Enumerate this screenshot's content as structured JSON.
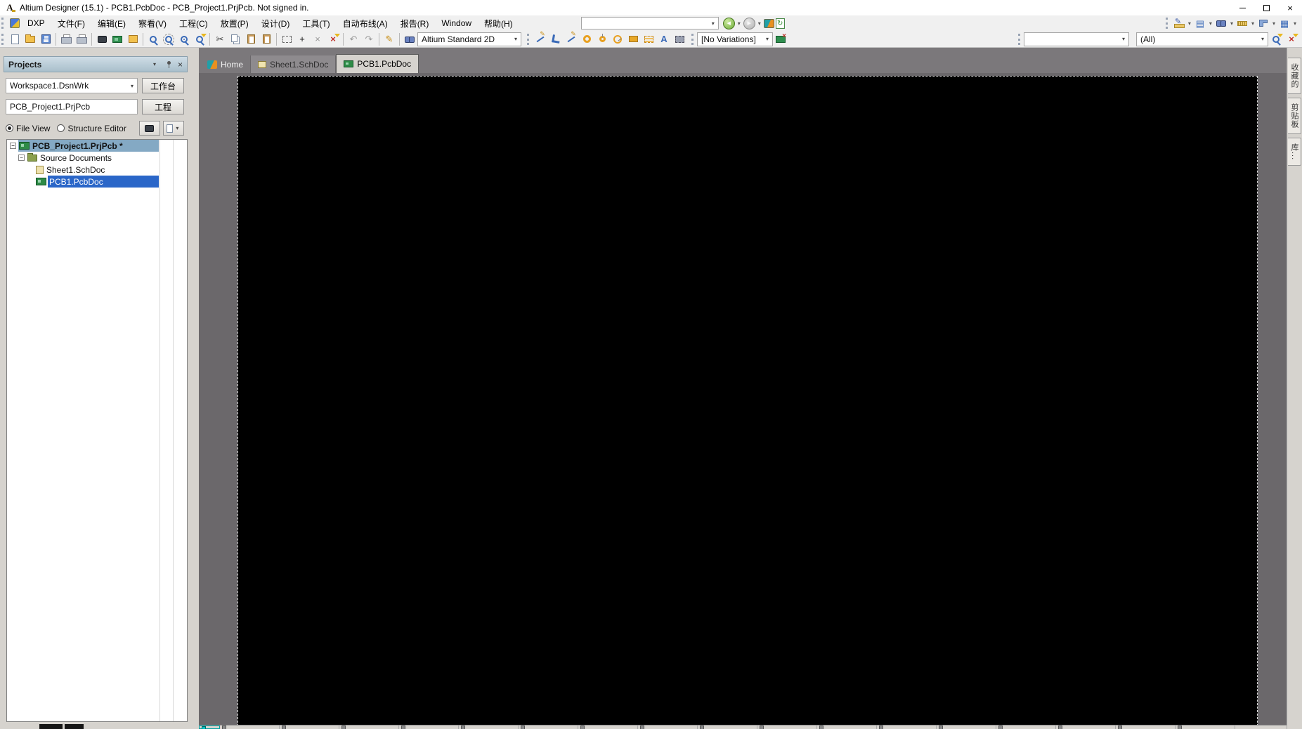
{
  "window": {
    "logo_glyph": "A",
    "title": "Altium Designer (15.1) - PCB1.PcbDoc - PCB_Project1.PrjPcb. Not signed in."
  },
  "glyphs": {
    "dropdown": "▾",
    "minus": "−",
    "close": "×",
    "cut": "✂",
    "undo": "↶",
    "redo": "↷",
    "pencil": "✎",
    "text_a": "A",
    "grid": "▦",
    "align": "▤",
    "back": "◀",
    "forward": "▶",
    "refresh": "↻",
    "move": "+",
    "cross": "×"
  },
  "menubar": {
    "items": [
      "DXP",
      "文件(F)",
      "编辑(E)",
      "察看(V)",
      "工程(C)",
      "放置(P)",
      "设计(D)",
      "工具(T)",
      "自动布线(A)",
      "报告(R)",
      "Window",
      "帮助(H)"
    ],
    "search_value": "",
    "nav_icons": [
      "back-icon",
      "forward-icon",
      "home-icon",
      "refresh-document-icon"
    ],
    "right_icons": [
      "drawing-tools-icon",
      "align-tools-icon",
      "find-tools-icon",
      "dimension-tools-icon",
      "room-tools-icon",
      "grid-tools-icon"
    ]
  },
  "toolbar": {
    "icons": [
      "new-document-icon",
      "open-document-icon",
      "save-icon",
      "print-icon",
      "print-preview-icon",
      "device-view-icon",
      "pcb-release-view-icon",
      "open-documents-icon",
      "fit-document-icon",
      "zoom-area-icon",
      "zoom-point-icon",
      "zoom-selected-icon",
      "cut-icon",
      "copy-icon",
      "paste-icon",
      "paste-special-icon",
      "select-area-icon",
      "move-icon",
      "deselect-icon",
      "clear-filter-icon",
      "undo-icon",
      "redo-icon",
      "annotate-icon",
      "browse-components-icon",
      "interactive-routing-icon",
      "route-icon",
      "differential-pair-routing-icon",
      "pad-icon",
      "via-icon",
      "arc-icon",
      "fill-icon",
      "polygon-pour-icon",
      "string-icon",
      "component-icon",
      "variant-board-icon",
      "apply-filter-icon",
      "clear-filter-funnel-icon"
    ],
    "view_config_value": "Altium Standard 2D",
    "variations_value": "[No Variations]",
    "mask_value": "",
    "filter_scope_value": "(All)"
  },
  "projects_panel": {
    "title": "Projects",
    "workspace_value": "Workspace1.DsnWrk",
    "workspace_button": "工作台",
    "project_value": "PCB_Project1.PrjPcb",
    "project_button": "工程",
    "file_view_label": "File View",
    "structure_editor_label": "Structure Editor",
    "tree": [
      {
        "label": "PCB_Project1.PrjPcb *",
        "type": "project",
        "expanded": true
      },
      {
        "label": "Source Documents",
        "type": "folder",
        "expanded": true
      },
      {
        "label": "Sheet1.SchDoc",
        "type": "schematic-document"
      },
      {
        "label": "PCB1.PcbDoc",
        "type": "pcb-document",
        "selected": true
      }
    ]
  },
  "document_tabs": [
    {
      "label": "Home",
      "active": false
    },
    {
      "label": "Sheet1.SchDoc",
      "active": false
    },
    {
      "label": "PCB1.PcbDoc",
      "active": true
    }
  ],
  "right_panel_tabs": [
    {
      "label": "收藏的"
    },
    {
      "label": "剪贴板"
    },
    {
      "label": "库..."
    }
  ],
  "colors": {
    "selection_blue": "#2a66c8",
    "project_row_highlight": "#84a9c4",
    "canvas_gray": "#6b686b",
    "board_black": "#000000",
    "panel_header": "#b3c7d2",
    "chrome_gray": "#f0f0f0",
    "tabbar_gray": "#7b787b"
  }
}
